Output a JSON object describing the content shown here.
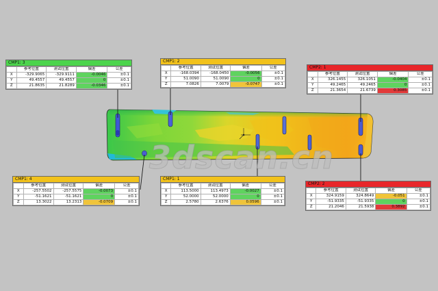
{
  "colors": {
    "background": "#c3c3c3",
    "header_green": "#4cd44c",
    "header_yellow": "#f2c21b",
    "header_red": "#e8262a",
    "cell_green": "#5fd35f",
    "cell_yellow": "#f0c43a",
    "cell_red": "#e23a3a"
  },
  "columns": [
    "",
    "参考位置",
    "测试位置",
    "偏差",
    "公差"
  ],
  "callouts": [
    {
      "id": "cmp1-3",
      "title": "CMP1: 3",
      "header_color": "#4cd44c",
      "rows": [
        {
          "axis": "X",
          "ref": "-329.9065",
          "meas": "-329.9111",
          "dev": "-0.0046",
          "dev_color": "#5fd35f",
          "tol": "±0.1"
        },
        {
          "axis": "Y",
          "ref": "49.4557",
          "meas": "49.4557",
          "dev": "0",
          "dev_color": "#5fd35f",
          "tol": "±0.1"
        },
        {
          "axis": "Z",
          "ref": "21.8635",
          "meas": "21.8289",
          "dev": "-0.0346",
          "dev_color": "#5fd35f",
          "tol": "±0.1"
        }
      ]
    },
    {
      "id": "cmp1-2",
      "title": "CMP1: 2",
      "header_color": "#f2c21b",
      "rows": [
        {
          "axis": "X",
          "ref": "-168.0394",
          "meas": "-168.0450",
          "dev": "-0.0056",
          "dev_color": "#5fd35f",
          "tol": "±0.1"
        },
        {
          "axis": "Y",
          "ref": "51.0090",
          "meas": "51.0090",
          "dev": "0",
          "dev_color": "#5fd35f",
          "tol": "±0.1"
        },
        {
          "axis": "Z",
          "ref": "7.0826",
          "meas": "7.0079",
          "dev": "-0.0747",
          "dev_color": "#f0c43a",
          "tol": "±0.1"
        }
      ]
    },
    {
      "id": "cmp2-1",
      "title": "CMP2: 1",
      "header_color": "#e8262a",
      "rows": [
        {
          "axis": "X",
          "ref": "326.1455",
          "meas": "326.1051",
          "dev": "-0.0404",
          "dev_color": "#5fd35f",
          "tol": "±0.1"
        },
        {
          "axis": "Y",
          "ref": "49.2465",
          "meas": "49.2465",
          "dev": "0",
          "dev_color": "#5fd35f",
          "tol": "±0.1"
        },
        {
          "axis": "Z",
          "ref": "21.3654",
          "meas": "21.6739",
          "dev": "0.3085",
          "dev_color": "#e23a3a",
          "tol": "±0.1"
        }
      ]
    },
    {
      "id": "cmp1-4",
      "title": "CMP1: 4",
      "header_color": "#f2c21b",
      "rows": [
        {
          "axis": "X",
          "ref": "-257.5502",
          "meas": "-257.5575",
          "dev": "-0.0073",
          "dev_color": "#5fd35f",
          "tol": "±0.1"
        },
        {
          "axis": "Y",
          "ref": "-51.1621",
          "meas": "-51.1621",
          "dev": "0",
          "dev_color": "#5fd35f",
          "tol": "±0.1"
        },
        {
          "axis": "Z",
          "ref": "13.3022",
          "meas": "13.2313",
          "dev": "-0.0709",
          "dev_color": "#f0c43a",
          "tol": "±0.1"
        }
      ]
    },
    {
      "id": "cmp1-1",
      "title": "CMP1: 1",
      "header_color": "#f2c21b",
      "rows": [
        {
          "axis": "X",
          "ref": "113.5000",
          "meas": "113.4973",
          "dev": "-0.0027",
          "dev_color": "#5fd35f",
          "tol": "±0.1"
        },
        {
          "axis": "Y",
          "ref": "52.0000",
          "meas": "52.0000",
          "dev": "0",
          "dev_color": "#5fd35f",
          "tol": "±0.1"
        },
        {
          "axis": "Z",
          "ref": "2.5780",
          "meas": "2.6376",
          "dev": "0.0596",
          "dev_color": "#f0c43a",
          "tol": "±0.1"
        }
      ]
    },
    {
      "id": "cmp2-2",
      "title": "CMP2: 2",
      "header_color": "#e8262a",
      "rows": [
        {
          "axis": "X",
          "ref": "324.9159",
          "meas": "324.8649",
          "dev": "-0.051",
          "dev_color": "#f0c43a",
          "tol": "±0.1"
        },
        {
          "axis": "Y",
          "ref": "-51.9335",
          "meas": "-51.9335",
          "dev": "0",
          "dev_color": "#5fd35f",
          "tol": "±0.1"
        },
        {
          "axis": "Z",
          "ref": "21.2046",
          "meas": "21.5938",
          "dev": "0.3892",
          "dev_color": "#e23a3a",
          "tol": "±0.1"
        }
      ]
    }
  ],
  "watermark": "3dscan.cn"
}
